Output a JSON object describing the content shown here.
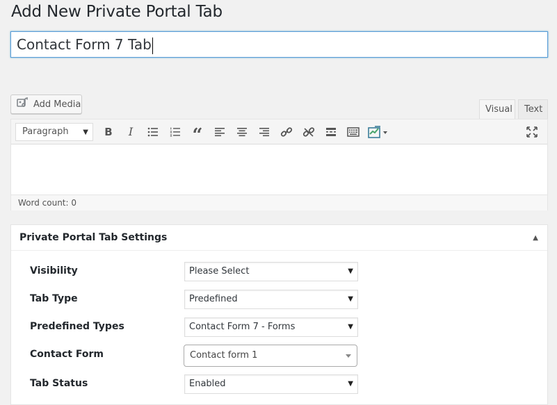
{
  "page": {
    "title": "Add New Private Portal Tab"
  },
  "title_input": {
    "value": "Contact Form 7 Tab"
  },
  "media": {
    "add_media_label": "Add Media",
    "icon": "media-icon"
  },
  "editor_tabs": {
    "visual": "Visual",
    "text": "Text"
  },
  "toolbar": {
    "format_value": "Paragraph",
    "buttons": [
      "bold-icon",
      "italic-icon",
      "bulleted-list-icon",
      "numbered-list-icon",
      "blockquote-icon",
      "align-left-icon",
      "align-center-icon",
      "align-right-icon",
      "link-icon",
      "unlink-icon",
      "read-more-icon",
      "toolbar-toggle-icon",
      "shortcode-icon",
      "fullscreen-icon"
    ],
    "bold_glyph": "B",
    "italic_glyph": "I",
    "quote_glyph": "“"
  },
  "status": {
    "word_count": "Word count: 0"
  },
  "settings": {
    "title": "Private Portal Tab Settings",
    "fields": [
      {
        "label": "Visibility",
        "value": "Please Select"
      },
      {
        "label": "Tab Type",
        "value": "Predefined"
      },
      {
        "label": "Predefined Types",
        "value": "Contact Form 7 - Forms"
      },
      {
        "label": "Contact Form",
        "value": "Contact form 1"
      },
      {
        "label": "Tab Status",
        "value": "Enabled"
      }
    ]
  },
  "colors": {
    "background": "#f1f1f1",
    "focus_border": "#5b9dd9",
    "text": "#23282d"
  }
}
